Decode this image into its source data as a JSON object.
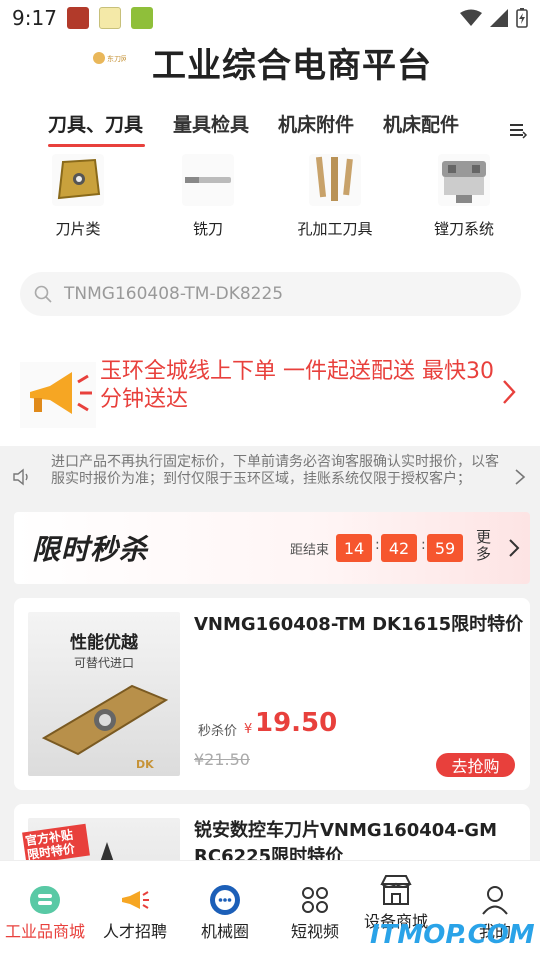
{
  "status_bar": {
    "time": "9:17"
  },
  "header": {
    "title": "工业综合电商平台",
    "logo_text": "东刀网"
  },
  "tabs": [
    {
      "label": "刀具、刀具"
    },
    {
      "label": "量具检具"
    },
    {
      "label": "机床附件"
    },
    {
      "label": "机床配件"
    }
  ],
  "categories": [
    {
      "label": "刀片类",
      "icon": "insert-icon"
    },
    {
      "label": "铣刀",
      "icon": "milling-cutter-icon"
    },
    {
      "label": "孔加工刀具",
      "icon": "drill-icon"
    },
    {
      "label": "镗刀系统",
      "icon": "boring-system-icon"
    }
  ],
  "search": {
    "placeholder": "TNMG160408-TM-DK8225"
  },
  "promo": {
    "text": "玉环全城线上下单 一件起送配送 最快30分钟送达"
  },
  "notice": {
    "text": "进口产品不再执行固定标价，下单前请务必咨询客服确认实时报价，以客服实时报价为准；到付仅限于玉环区域，挂账系统仅限于授权客户；"
  },
  "flash_sale": {
    "title": "限时秒杀",
    "end_label": "距结束",
    "hours": "14",
    "minutes": "42",
    "seconds": "59",
    "more_label": "更多"
  },
  "products": [
    {
      "name": "VNMG160408-TM DK1615限时特价",
      "image_title": "性能优越",
      "image_subtitle": "可替代进口",
      "image_brand": "DK",
      "sale_label": "秒杀价",
      "currency": "¥",
      "price": "19.50",
      "old_price": "¥21.50",
      "buy_label": "去抢购"
    },
    {
      "name": "锐安数控车刀片VNMG160404-GM RC6225限时特价",
      "image_badge": "官方补贴 限时特价"
    }
  ],
  "bottom_nav": [
    {
      "label": "工业品商城",
      "icon": "mall-icon"
    },
    {
      "label": "人才招聘",
      "icon": "megaphone-icon"
    },
    {
      "label": "机械圈",
      "icon": "chat-icon"
    },
    {
      "label": "短视频",
      "icon": "grid-icon"
    },
    {
      "label": "设备商城",
      "icon": "store-icon"
    },
    {
      "label": "我的",
      "icon": "user-icon"
    }
  ],
  "watermark": "ITMOP.COM",
  "colors": {
    "accent": "#e8403c",
    "timer": "#f6562e",
    "watermark": "#2aa3e8"
  }
}
